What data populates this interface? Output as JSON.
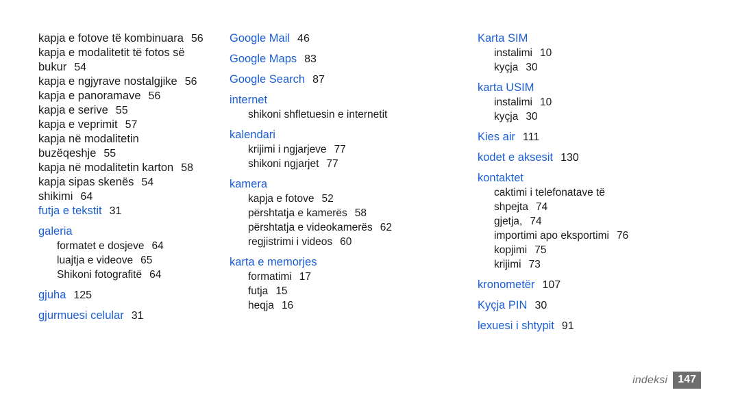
{
  "document": {
    "type": "index",
    "footer": {
      "label": "indeksi",
      "page_number": "147"
    },
    "colors": {
      "heading": "#1c5fd4",
      "body_text": "#1a1a1a",
      "footer_gray": "#6e6e6e",
      "page_background": "#ffffff"
    }
  },
  "columns": [
    {
      "id": "column-1",
      "groups": [
        {
          "kind": "continuation",
          "entries": [
            {
              "text": "kapja e fotove të kombinuara",
              "page": "56"
            },
            {
              "text": "kapja e modalitetit të fotos së",
              "page": ""
            },
            {
              "text": "bukur",
              "page": "54"
            },
            {
              "text": "kapja e ngjyrave nostalgjike",
              "page": "56"
            },
            {
              "text": "kapja e panoramave",
              "page": "56"
            },
            {
              "text": "kapja e serive",
              "page": "55"
            },
            {
              "text": "kapja e veprimit",
              "page": "57"
            },
            {
              "text": "kapja në modalitetin",
              "page": ""
            },
            {
              "text": "buzëqeshje",
              "page": "55"
            },
            {
              "text": "kapja në modalitetin karton",
              "page": "58"
            },
            {
              "text": "kapja sipas skenës",
              "page": "54"
            },
            {
              "text": "shikimi",
              "page": "64"
            }
          ]
        },
        {
          "kind": "heading",
          "heading": "futja e tekstit",
          "page": "31",
          "entries": []
        },
        {
          "kind": "heading",
          "heading": "galeria",
          "page": "",
          "entries": [
            {
              "text": "formatet e dosjeve",
              "page": "64"
            },
            {
              "text": "luajtja e videove",
              "page": "65"
            },
            {
              "text": "Shikoni fotografitë",
              "page": "64"
            }
          ]
        },
        {
          "kind": "heading",
          "heading": "gjuha",
          "page": "125",
          "entries": []
        },
        {
          "kind": "heading",
          "heading": "gjurmuesi celular",
          "page": "31",
          "entries": []
        }
      ]
    },
    {
      "id": "column-2",
      "groups": [
        {
          "kind": "heading",
          "heading": "Google Mail",
          "page": "46",
          "entries": []
        },
        {
          "kind": "heading",
          "heading": "Google Maps",
          "page": "83",
          "entries": []
        },
        {
          "kind": "heading",
          "heading": "Google Search",
          "page": "87",
          "entries": []
        },
        {
          "kind": "heading",
          "heading": "internet",
          "page": "",
          "entries": [
            {
              "text": "shikoni shfletuesin e internetit",
              "page": ""
            }
          ]
        },
        {
          "kind": "heading",
          "heading": "kalendari",
          "page": "",
          "entries": [
            {
              "text": "krijimi i ngjarjeve",
              "page": "77"
            },
            {
              "text": "shikoni ngjarjet",
              "page": "77"
            }
          ]
        },
        {
          "kind": "heading",
          "heading": "kamera",
          "page": "",
          "entries": [
            {
              "text": "kapja e fotove",
              "page": "52"
            },
            {
              "text": "përshtatja e kamerës",
              "page": "58"
            },
            {
              "text": "përshtatja e videokamerës",
              "page": "62"
            },
            {
              "text": "regjistrimi i videos",
              "page": "60"
            }
          ]
        },
        {
          "kind": "heading",
          "heading": "karta e memorjes",
          "page": "",
          "entries": [
            {
              "text": "formatimi",
              "page": "17"
            },
            {
              "text": "futja",
              "page": "15"
            },
            {
              "text": "heqja",
              "page": "16"
            }
          ]
        }
      ]
    },
    {
      "id": "column-3",
      "groups": [
        {
          "kind": "heading",
          "heading": "Karta SIM",
          "page": "",
          "entries": [
            {
              "text": "instalimi",
              "page": "10"
            },
            {
              "text": "kyçja",
              "page": "30"
            }
          ]
        },
        {
          "kind": "heading",
          "heading": "karta USIM",
          "page": "",
          "entries": [
            {
              "text": "instalimi",
              "page": "10"
            },
            {
              "text": "kyçja",
              "page": "30"
            }
          ]
        },
        {
          "kind": "heading",
          "heading": "Kies air",
          "page": "111",
          "entries": []
        },
        {
          "kind": "heading",
          "heading": "kodet e aksesit",
          "page": "130",
          "entries": []
        },
        {
          "kind": "heading",
          "heading": "kontaktet",
          "page": "",
          "entries": [
            {
              "text": "caktimi i telefonatave të",
              "page": ""
            },
            {
              "text": "shpejta",
              "page": "74"
            },
            {
              "text": "gjetja,",
              "page": "74"
            },
            {
              "text": "importimi apo eksportimi",
              "page": "76"
            },
            {
              "text": "kopjimi",
              "page": "75"
            },
            {
              "text": "krijimi",
              "page": "73"
            }
          ]
        },
        {
          "kind": "heading",
          "heading": "kronometër",
          "page": "107",
          "entries": []
        },
        {
          "kind": "heading",
          "heading": "Kyçja PIN",
          "page": "30",
          "entries": []
        },
        {
          "kind": "heading",
          "heading": "lexuesi i shtypit",
          "page": "91",
          "entries": []
        }
      ]
    }
  ]
}
